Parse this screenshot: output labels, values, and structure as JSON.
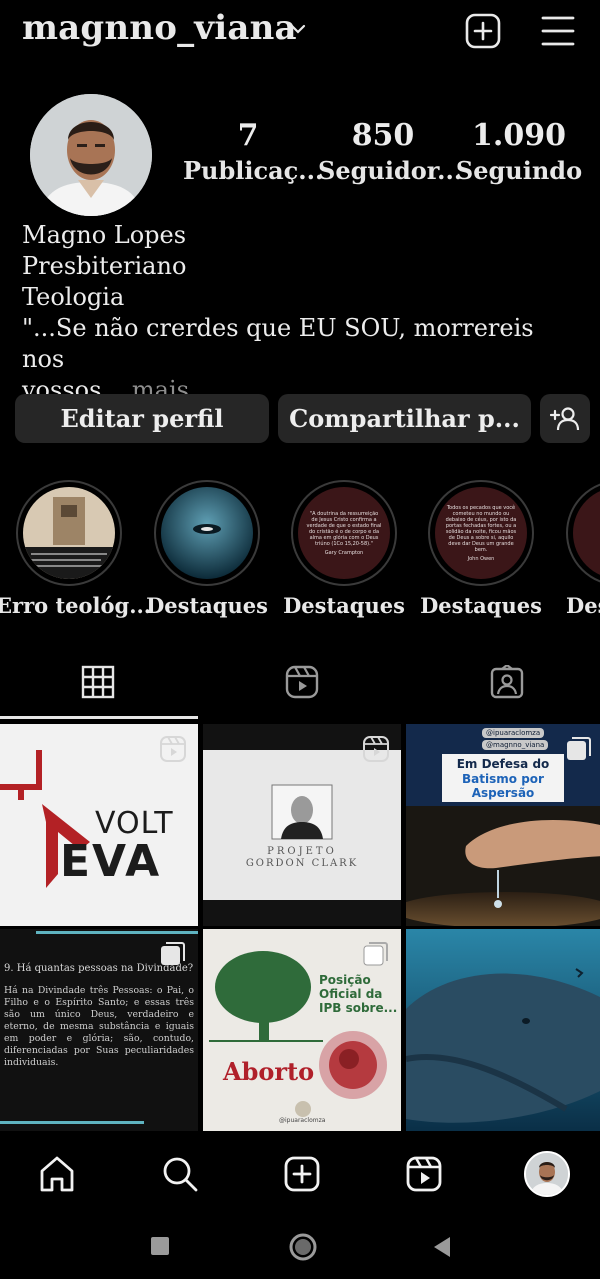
{
  "header": {
    "username": "magnno_viana"
  },
  "stats": [
    {
      "value": "7",
      "label": "Publicaç..."
    },
    {
      "value": "850",
      "label": "Seguidor..."
    },
    {
      "value": "1.090",
      "label": "Seguindo"
    }
  ],
  "bio": {
    "name": "Magno Lopes",
    "line1": "Presbiteriano",
    "line2": "Teologia",
    "quote_line1": "\"...Se não crerdes que EU SOU, morrereis nos",
    "quote_line2": "vossos...",
    "more": " mais"
  },
  "buttons": {
    "edit": "Editar perfil",
    "share": "Compartilhar p..."
  },
  "highlights": [
    {
      "label": "Erro teológ..."
    },
    {
      "label": "Destaques"
    },
    {
      "label": "Destaques",
      "quote": "\"A doutrina da ressurreição de Jesus Cristo confirma a verdade de que o estado final do cristão é o de corpo e da alma em glória com o Deus triúno (1Co 15,20-58).\"",
      "author": "Gary Crampton"
    },
    {
      "label": "Destaques",
      "quote": "Todos os pecados que você cometeu no mundo ou debaixo de céus, por isto da portas fechadas fortes, ou a solidão da noite, ficou mãos de Deus a sobre si, aquilo deve dar Deus um grande bem.",
      "author": "John Owen"
    },
    {
      "label": "Des"
    }
  ],
  "posts": {
    "volteva": {
      "line1": "VOLT",
      "line2": "EVA"
    },
    "gordon": {
      "line1": "PROJETO",
      "line2": "GORDON CLARK"
    },
    "batismo": {
      "handle1": "@ipuaraclomza",
      "handle2": "@magnno_viana",
      "title1": "Em Defesa do",
      "title2": "Batismo por",
      "title3": "Aspersão"
    },
    "catecismo": {
      "question": "9. Há quantas pessoas na Divindade?",
      "answer": "Há na Divindade três Pessoas: o Pai, o Filho e o Espírito Santo; e essas três são um único Deus, verdadeiro e eterno, de mesma substância e iguais em poder e glória; são, contudo, diferenciadas por Suas peculiaridades individuais."
    },
    "aborto": {
      "title": "Posição Oficial da IPB sobre...",
      "word": "Aborto",
      "handle": "@ipuaraclomza"
    }
  },
  "colors": {
    "background": "#000000",
    "button": "#262626",
    "highlight_maroon": "#3b1618",
    "batismo_navy": "#13294b",
    "aborto_green": "#2f6b3a"
  }
}
